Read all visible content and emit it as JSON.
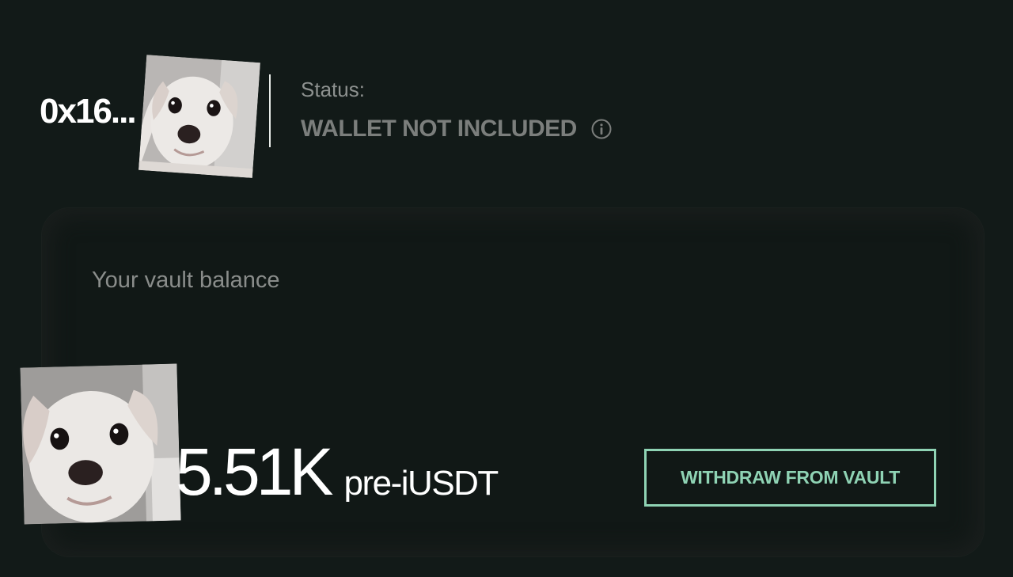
{
  "header": {
    "wallet_address": "0x16...",
    "status_label": "Status:",
    "status_value": "WALLET NOT INCLUDED",
    "status_info_icon": "info-icon"
  },
  "vault": {
    "label": "Your vault balance",
    "balance_amount": "5.51K",
    "balance_unit": "pre-iUSDT",
    "withdraw_label": "WITHDRAW FROM VAULT"
  },
  "colors": {
    "background": "#121a18",
    "accent": "#8fd3b4",
    "muted_text": "#8a8d8b",
    "status_text": "#7b7e7c"
  }
}
